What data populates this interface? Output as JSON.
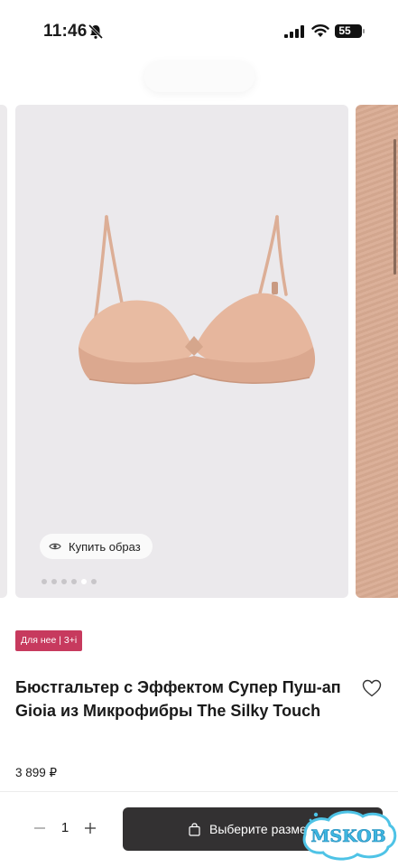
{
  "status_bar": {
    "time": "11:46",
    "battery": "55",
    "icons": [
      "bell-slash-icon",
      "signal-icon",
      "wifi-icon",
      "battery-icon"
    ]
  },
  "gallery": {
    "buy_look_label": "Купить образ",
    "buy_look_icon": "eye-icon",
    "dots_total": 6,
    "dots_active": 5,
    "image_colors": {
      "background": "#ebe9ec",
      "product": "#e6b8a0",
      "next_slide": "#d9ab93"
    }
  },
  "product": {
    "tag": "Для нее | 3+i",
    "tag_color": "#c73a5e",
    "title": "Бюстгальтер с Эффектом Супер Пуш-ап Gioia из Микрофибры The Silky Touch",
    "price": "3 899 ₽",
    "favorite_icon": "heart-icon"
  },
  "cart_bar": {
    "quantity": "1",
    "minus_icon": "minus-icon",
    "plus_icon": "plus-icon",
    "button_label": "Выберите размер",
    "button_icon": "shopping-bag-icon",
    "button_color": "#333132"
  },
  "watermark": {
    "text": "MSKOB"
  }
}
